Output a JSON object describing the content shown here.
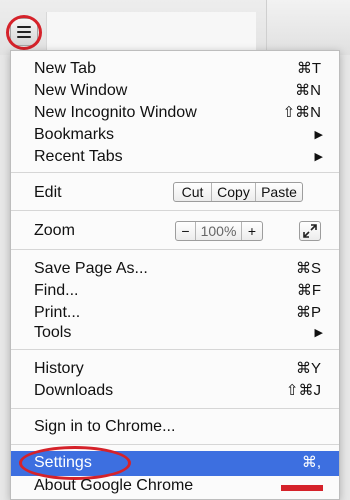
{
  "menu": {
    "items": [
      {
        "label": "New Tab",
        "shortcut": "⌘T"
      },
      {
        "label": "New Window",
        "shortcut": "⌘N"
      },
      {
        "label": "New Incognito Window",
        "shortcut": "⇧⌘N"
      },
      {
        "label": "Bookmarks",
        "arrow": "▶"
      },
      {
        "label": "Recent Tabs",
        "arrow": "▶"
      }
    ],
    "edit": {
      "label": "Edit",
      "cut": "Cut",
      "copy": "Copy",
      "paste": "Paste"
    },
    "zoom": {
      "label": "Zoom",
      "minus": "−",
      "value": "100%",
      "plus": "+"
    },
    "page_items": [
      {
        "label": "Save Page As...",
        "shortcut": "⌘S"
      },
      {
        "label": "Find...",
        "shortcut": "⌘F"
      },
      {
        "label": "Print...",
        "shortcut": "⌘P"
      },
      {
        "label": "Tools",
        "arrow": "▶"
      }
    ],
    "history": {
      "label": "History",
      "shortcut": "⌘Y"
    },
    "downloads": {
      "label": "Downloads",
      "shortcut": "⇧⌘J"
    },
    "sign_in": {
      "label": "Sign in to Chrome..."
    },
    "settings": {
      "label": "Settings",
      "shortcut": "⌘,"
    },
    "about": {
      "label": "About Google Chrome"
    }
  },
  "colors": {
    "highlight": "#3d6fe0",
    "annotation_ring": "#d5222a"
  },
  "icons": {
    "menu_button": "hamburger-menu-icon",
    "fullscreen": "fullscreen-expand-icon"
  }
}
